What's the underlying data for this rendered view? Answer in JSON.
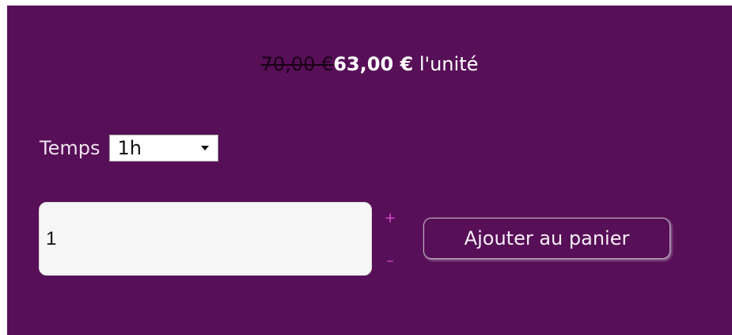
{
  "price": {
    "old": "70,00 €",
    "new": "63,00 €",
    "unit": " l'unité"
  },
  "option": {
    "label": "Temps",
    "selected": "1h",
    "icon": "chevron-down-icon"
  },
  "quantity": {
    "value": "1",
    "plus": "+",
    "minus": "–"
  },
  "cart": {
    "add_label": "Ajouter au panier"
  },
  "colors": {
    "background": "#570f57",
    "stepper": "#d94ad0",
    "old_price": "#1a0018"
  }
}
